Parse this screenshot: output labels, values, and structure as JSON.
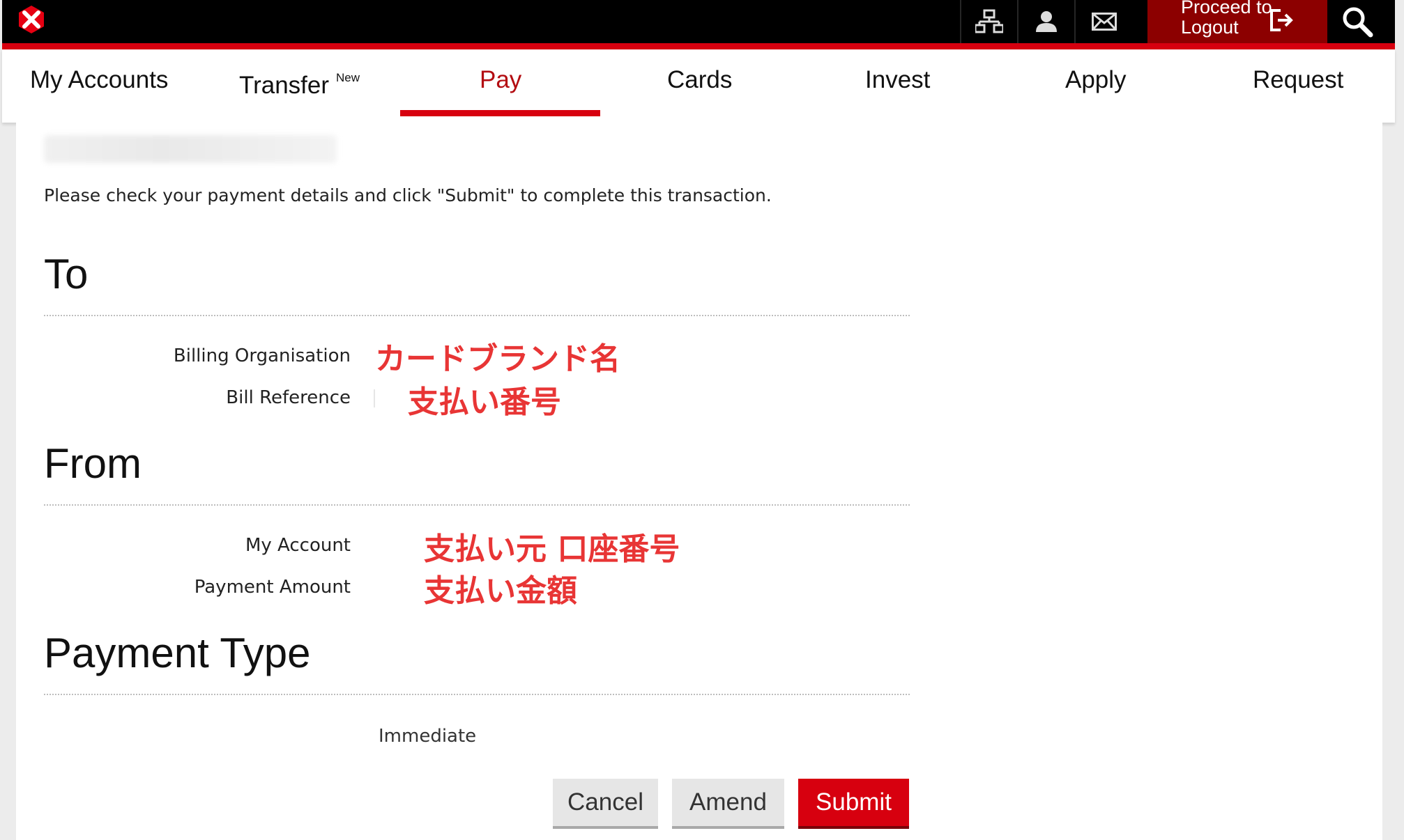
{
  "header": {
    "logo_icon": "hexagon-logo-icon",
    "icons": [
      "sitemap-icon",
      "user-icon",
      "mail-icon"
    ],
    "logout_label_line1": "Proceed to",
    "logout_label_line2": "Logout",
    "logout_icon": "logout-icon",
    "search_icon": "search-icon",
    "brand_red": "#d7000f",
    "logout_bg": "#8c0000"
  },
  "nav": {
    "items": [
      {
        "label": "My Accounts"
      },
      {
        "label": "Transfer",
        "badge": "New"
      },
      {
        "label": "Pay",
        "active": true
      },
      {
        "label": "Cards"
      },
      {
        "label": "Invest"
      },
      {
        "label": "Apply"
      },
      {
        "label": "Request"
      }
    ]
  },
  "content": {
    "intro": "Please check your payment details and click \"Submit\" to complete this transaction.",
    "to": {
      "title": "To",
      "billing_org_label": "Billing Organisation",
      "billing_org_value": "カードブランド名",
      "bill_ref_label": "Bill Reference",
      "bill_ref_value": "支払い番号"
    },
    "from": {
      "title": "From",
      "my_account_label": "My Account",
      "my_account_value": "支払い元 口座番号",
      "amount_label": "Payment Amount",
      "amount_value": "支払い金額"
    },
    "payment_type": {
      "title": "Payment Type",
      "value": "Immediate"
    },
    "buttons": {
      "cancel": "Cancel",
      "amend": "Amend",
      "submit": "Submit"
    },
    "annotation_color": "#e83535"
  }
}
